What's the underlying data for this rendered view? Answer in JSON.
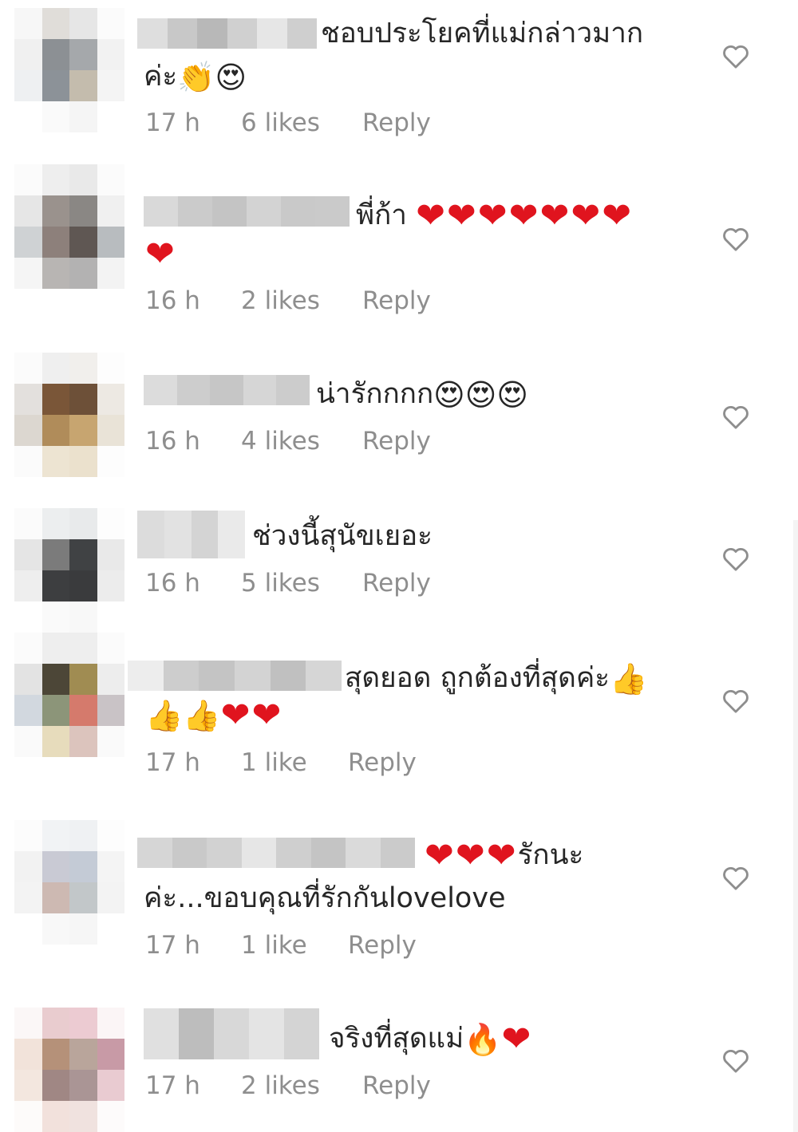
{
  "comments": [
    {
      "text_line1": "ชอบประโยคที่แม่กล่าวมาก",
      "text_line2": "ค่ะ",
      "emoji_line2": "👏😍",
      "time": "17 h",
      "likes": "6 likes",
      "reply": "Reply"
    },
    {
      "text_line1": "พี่ก้า",
      "hearts_line1": "❤❤❤❤❤❤❤",
      "hearts_line2": "❤",
      "time": "16 h",
      "likes": "2 likes",
      "reply": "Reply"
    },
    {
      "text_line1": "น่ารักกกก",
      "emoji_line1": "😍😍😍",
      "time": "16 h",
      "likes": "4 likes",
      "reply": "Reply"
    },
    {
      "text_line1": "ช่วงนี้สุนัขเยอะ",
      "time": "16 h",
      "likes": "5 likes",
      "reply": "Reply"
    },
    {
      "text_line1": "สุดยอด ถูกต้องที่สุดค่ะ",
      "emoji_line1": "👍",
      "emoji_line2": "👍👍",
      "hearts_line2": "❤❤",
      "time": "17 h",
      "likes": "1 like",
      "reply": "Reply"
    },
    {
      "hearts_line1": "❤❤❤",
      "text_line1": "รักนะ",
      "text_line2": "ค่ะ...ขอบคุณที่รักกันlovelove",
      "time": "17 h",
      "likes": "1 like",
      "reply": "Reply"
    },
    {
      "text_line1": "จริงที่สุดแม่",
      "emoji_line1": "🔥",
      "hearts_line1": "❤",
      "time": "17 h",
      "likes": "2 likes",
      "reply": "Reply"
    }
  ],
  "colors": {
    "text": "#262626",
    "meta": "#8e8e8e",
    "heart_icon": "#8e8e8e",
    "red_heart": "#e0141e"
  },
  "icons": {
    "like": "heart-outline-icon"
  }
}
